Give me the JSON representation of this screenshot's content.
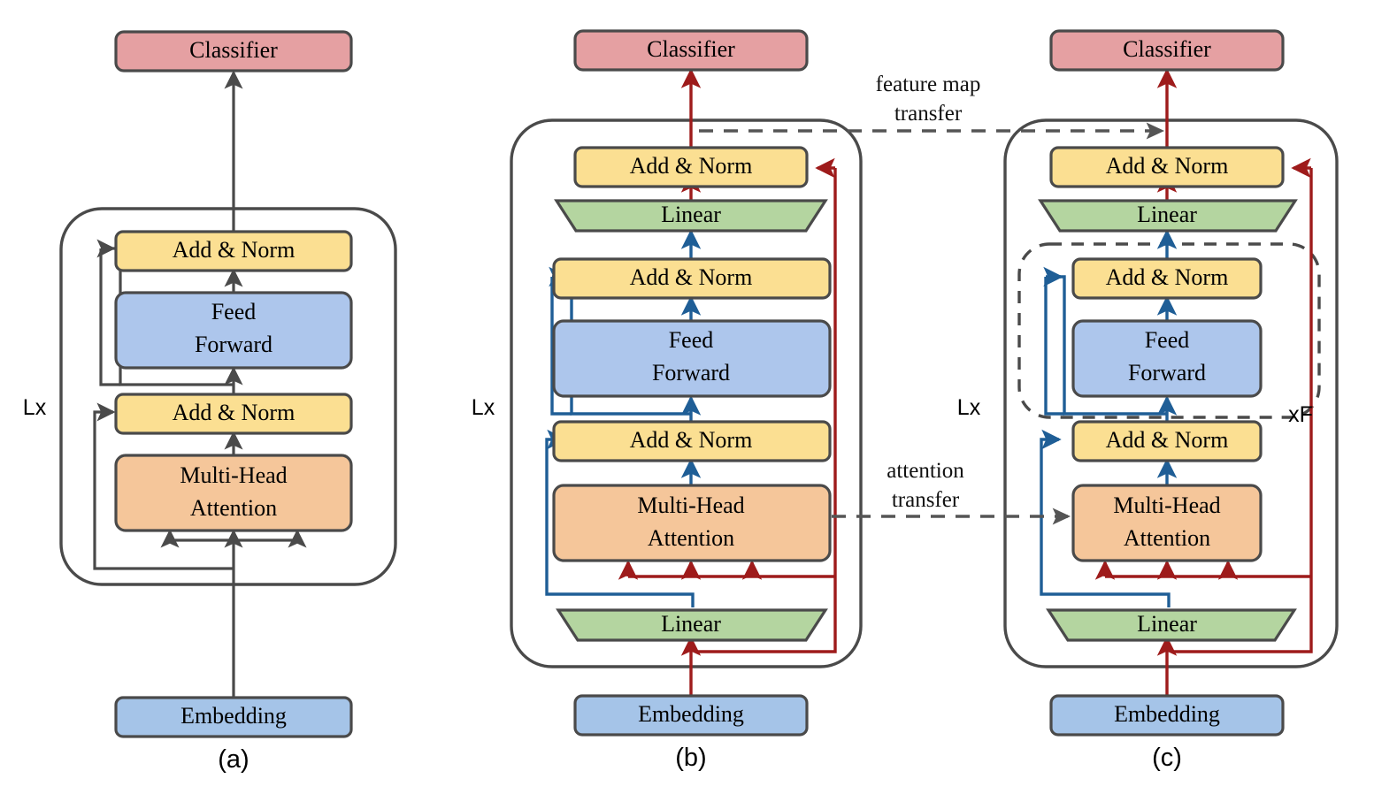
{
  "figure": {
    "title": "Transformer knowledge distillation architectures",
    "colors": {
      "classifier": "#e5a0a2",
      "add_norm": "#fbdf92",
      "feed_forward": "#adc6ec",
      "attention": "#f5c69a",
      "linear": "#b4d5a0",
      "embedding": "#a5c4e8",
      "outline": "#4a4a4a",
      "flow_red": "#9e1b1b",
      "flow_blue": "#1f5e96",
      "flow_gray": "#4a4a4a",
      "transfer_dash": "#555555"
    },
    "panels": [
      {
        "id": "a",
        "caption": "(a)",
        "loop_label": "Lx",
        "nodes": [
          {
            "name": "classifier",
            "label": "Classifier"
          },
          {
            "name": "add-norm-top",
            "label": "Add & Norm"
          },
          {
            "name": "feed-forward",
            "label": "Feed\nForward"
          },
          {
            "name": "add-norm-bottom",
            "label": "Add & Norm"
          },
          {
            "name": "multi-head-attention",
            "label": "Multi-Head\nAttention"
          },
          {
            "name": "embedding",
            "label": "Embedding"
          }
        ]
      },
      {
        "id": "b",
        "caption": "(b)",
        "loop_label": "Lx",
        "nodes": [
          {
            "name": "classifier",
            "label": "Classifier"
          },
          {
            "name": "add-norm-outer",
            "label": "Add & Norm"
          },
          {
            "name": "linear-top",
            "label": "Linear"
          },
          {
            "name": "add-norm-top",
            "label": "Add & Norm"
          },
          {
            "name": "feed-forward",
            "label": "Feed\nForward"
          },
          {
            "name": "add-norm-bottom",
            "label": "Add & Norm"
          },
          {
            "name": "multi-head-attention",
            "label": "Multi-Head\nAttention"
          },
          {
            "name": "linear-bottom",
            "label": "Linear"
          },
          {
            "name": "embedding",
            "label": "Embedding"
          }
        ]
      },
      {
        "id": "c",
        "caption": "(c)",
        "loop_label": "Lx",
        "inner_loop_label": "xF",
        "nodes": [
          {
            "name": "classifier",
            "label": "Classifier"
          },
          {
            "name": "add-norm-outer",
            "label": "Add & Norm"
          },
          {
            "name": "linear-top",
            "label": "Linear"
          },
          {
            "name": "add-norm-top",
            "label": "Add & Norm"
          },
          {
            "name": "feed-forward",
            "label": "Feed\nForward"
          },
          {
            "name": "add-norm-bottom",
            "label": "Add & Norm"
          },
          {
            "name": "multi-head-attention",
            "label": "Multi-Head\nAttention"
          },
          {
            "name": "linear-bottom",
            "label": "Linear"
          },
          {
            "name": "embedding",
            "label": "Embedding"
          }
        ]
      }
    ],
    "transfers": [
      {
        "name": "feature-map-transfer",
        "line1": "feature map",
        "line2": "transfer"
      },
      {
        "name": "attention-transfer",
        "line1": "attention",
        "line2": "transfer"
      }
    ],
    "labels": {
      "classifier": "Classifier",
      "add_norm": "Add & Norm",
      "feed_forward_l1": "Feed",
      "feed_forward_l2": "Forward",
      "attention_l1": "Multi-Head",
      "attention_l2": "Attention",
      "linear": "Linear",
      "embedding": "Embedding",
      "lx": "Lx",
      "xf": "xF",
      "caption_a": "(a)",
      "caption_b": "(b)",
      "caption_c": "(c)",
      "feature_map_l1": "feature map",
      "feature_map_l2": "transfer",
      "attention_transfer_l1": "attention",
      "attention_transfer_l2": "transfer"
    }
  }
}
